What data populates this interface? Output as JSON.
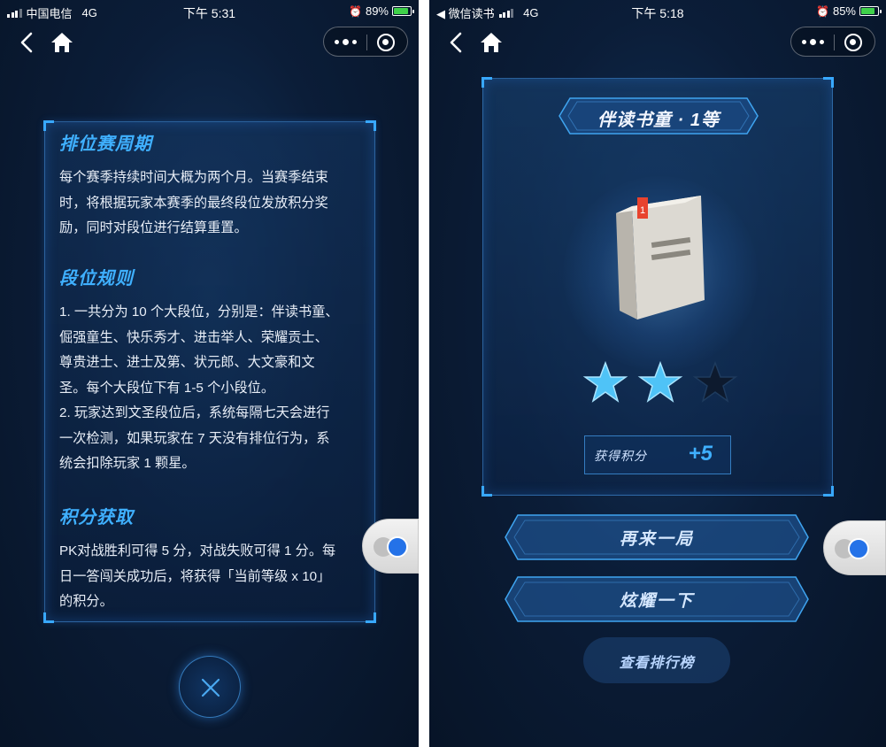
{
  "left_phone": {
    "status_bar": {
      "carrier": "中国电信",
      "network": "4G",
      "time": "下午 5:31",
      "battery": "89%"
    },
    "rules": [
      {
        "heading": "排位赛周期",
        "text": "每个赛季持续时间大概为两个月。当赛季结束\n时，将根据玩家本赛季的最终段位发放积分奖\n励，同时对段位进行结算重置。"
      },
      {
        "heading": "段位规则",
        "text": "1. 一共分为 10 个大段位，分别是：伴读书童、\n倔强童生、快乐秀才、进击举人、荣耀贡士、\n尊贵进士、进士及第、状元郎、大文豪和文\n圣。每个大段位下有 1-5 个小段位。\n2. 玩家达到文圣段位后，系统每隔七天会进行\n一次检测，如果玩家在 7 天没有排位行为，系\n统会扣除玩家 1 颗星。"
      },
      {
        "heading": "积分获取",
        "text": "PK对战胜利可得 5 分，对战失败可得 1 分。每\n日一答闯关成功后，将获得「当前等级 x 10」\n的积分。"
      }
    ]
  },
  "right_phone": {
    "status_bar": {
      "back_app": "◀ 微信读书",
      "network": "4G",
      "time": "下午 5:18",
      "battery": "85%"
    },
    "rank_title": "伴读书童 · 1等",
    "stars": {
      "earned": 2,
      "total": 3
    },
    "book_badge": "1",
    "score": {
      "label": "获得积分",
      "value": "+5"
    },
    "buttons": {
      "again": "再来一局",
      "share": "炫耀一下",
      "leaderboard": "查看排行榜"
    }
  },
  "colors": {
    "accent": "#3fb0ff",
    "background": "#0b1d38",
    "star_active": "#4fc3f7",
    "star_inactive": "#0d1a2e",
    "book_tag": "#e8432e"
  },
  "icons": [
    "back-icon",
    "home-icon",
    "more-icon",
    "close-miniprogram-icon",
    "close-icon",
    "link-icon",
    "star-icon",
    "book-icon"
  ]
}
